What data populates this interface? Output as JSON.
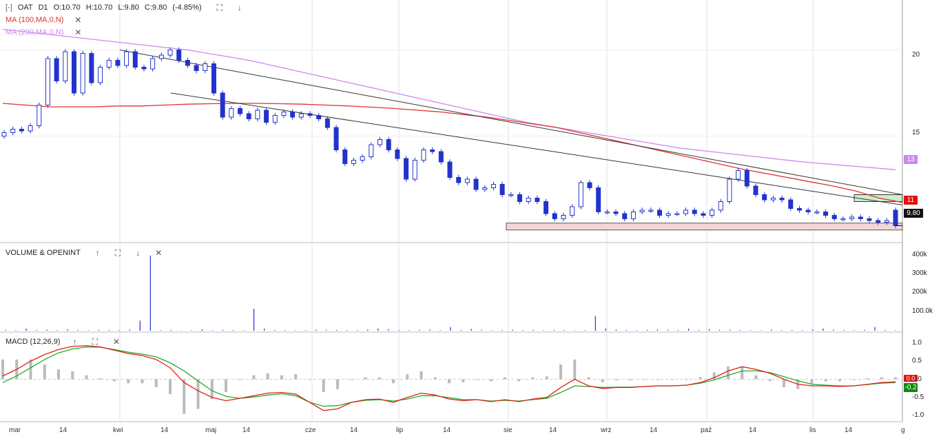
{
  "header": {
    "collapse_icon": "[-]",
    "symbol": "OAT",
    "interval": "D1",
    "open": "O:10.70",
    "high": "H:10.70",
    "low": "L:9.80",
    "close": "C:9.80",
    "change": "(-4.85%)"
  },
  "indicators": {
    "ma100": "MA (100,MA,0,N)",
    "ma200": "MA (200,MA,0,N)",
    "volume": "VOLUME & OPENINT",
    "macd": "MACD (12,26,9)"
  },
  "colors": {
    "candle": "#2233cc",
    "ma100": "#e03030",
    "ma200": "#cc88ee",
    "trendline": "#333333",
    "macd_line": "#e02020",
    "signal_line": "#22aa22",
    "histogram": "#bbbbbb",
    "zone_support": "#f3d6d6",
    "zone_resistance": "#ccefcc"
  },
  "price_axis": {
    "labels": [
      "20",
      "15"
    ],
    "ylim": [
      9.3,
      22.5
    ]
  },
  "volume_axis": {
    "labels": [
      "400k",
      "300k",
      "200k",
      "100.0k"
    ]
  },
  "macd_axis": {
    "labels": [
      "1.0",
      "0.5",
      "0.0",
      "-0.5",
      "-1.0"
    ]
  },
  "badges": {
    "ma200": "13",
    "ma100": "11",
    "last": "9.80",
    "macd": "-0.2",
    "signal": "0.0"
  },
  "x_labels": [
    "mar",
    "14",
    "kwi",
    "14",
    "maj",
    "14",
    "cze",
    "14",
    "lip",
    "14",
    "sie",
    "14",
    "wrz",
    "14",
    "paź",
    "14",
    "lis",
    "14",
    "g"
  ],
  "chart_data": [
    {
      "type": "candlestick",
      "symbol": "OAT",
      "interval": "D1",
      "ylim": [
        9.3,
        22.5
      ],
      "close": [
        15.2,
        15.4,
        15.3,
        15.6,
        16.8,
        19.5,
        18.2,
        19.9,
        17.5,
        19.8,
        18.1,
        19.0,
        19.4,
        19.1,
        19.9,
        19.0,
        18.9,
        19.5,
        19.7,
        20.0,
        19.4,
        19.1,
        18.8,
        19.2,
        17.5,
        16.1,
        16.6,
        16.3,
        16.0,
        16.5,
        15.8,
        16.2,
        16.4,
        16.1,
        16.3,
        16.2,
        16.0,
        15.5,
        14.2,
        13.4,
        13.6,
        13.8,
        14.5,
        14.8,
        14.2,
        13.7,
        12.5,
        13.6,
        14.2,
        14.1,
        13.5,
        12.6,
        12.3,
        12.5,
        11.9,
        12.0,
        12.2,
        11.6,
        11.6,
        11.2,
        11.4,
        11.2,
        10.5,
        10.2,
        10.4,
        10.9,
        12.3,
        12.0,
        10.6,
        10.6,
        10.5,
        10.2,
        10.6,
        10.7,
        10.7,
        10.4,
        10.5,
        10.5,
        10.7,
        10.5,
        10.4,
        10.7,
        11.2,
        12.5,
        13.0,
        12.1,
        11.6,
        11.3,
        11.4,
        11.3,
        10.8,
        10.7,
        10.6,
        10.6,
        10.4,
        10.2,
        10.2,
        10.3,
        10.2,
        10.1,
        10.0,
        10.1,
        9.8
      ],
      "open": [
        15.0,
        15.2,
        15.4,
        15.3,
        15.6,
        16.8,
        19.5,
        18.2,
        19.9,
        17.5,
        19.8,
        18.1,
        19.0,
        19.4,
        19.1,
        19.9,
        19.0,
        18.9,
        19.5,
        19.7,
        20.0,
        19.4,
        19.1,
        18.8,
        19.2,
        17.5,
        16.1,
        16.6,
        16.3,
        16.0,
        16.5,
        15.8,
        16.2,
        16.4,
        16.1,
        16.3,
        16.2,
        16.0,
        15.5,
        14.2,
        13.4,
        13.6,
        13.8,
        14.5,
        14.8,
        14.2,
        13.7,
        12.5,
        13.6,
        14.2,
        14.1,
        13.5,
        12.6,
        12.3,
        12.5,
        11.9,
        12.0,
        12.2,
        11.6,
        11.6,
        11.2,
        11.4,
        11.2,
        10.5,
        10.2,
        10.4,
        10.9,
        12.3,
        12.0,
        10.6,
        10.6,
        10.5,
        10.2,
        10.6,
        10.7,
        10.7,
        10.4,
        10.5,
        10.5,
        10.7,
        10.5,
        10.4,
        10.7,
        11.2,
        12.5,
        13.0,
        12.1,
        11.6,
        11.3,
        11.4,
        11.3,
        10.8,
        10.7,
        10.6,
        10.6,
        10.4,
        10.2,
        10.2,
        10.3,
        10.2,
        10.1,
        10.0,
        10.7
      ],
      "ma100": [
        16.9,
        16.8,
        16.7,
        16.7,
        16.7,
        16.75,
        16.75,
        16.8,
        16.85,
        16.88,
        16.9,
        16.9,
        16.88,
        16.85,
        16.8,
        16.75,
        16.68,
        16.6,
        16.5,
        16.4,
        16.25,
        16.1,
        15.9,
        15.7,
        15.5,
        15.2,
        14.9,
        14.6,
        14.3,
        14.0,
        13.7,
        13.4,
        13.1,
        12.85,
        12.6,
        12.35,
        12.1,
        11.8,
        11.4,
        11.15
      ],
      "ma200": [
        21.2,
        21.0,
        20.8,
        20.6,
        20.4,
        20.2,
        20.0,
        19.7,
        19.4,
        19.0,
        18.6,
        18.2,
        17.8,
        17.4,
        17.0,
        16.6,
        16.2,
        15.8,
        15.5,
        15.2,
        14.9,
        14.6,
        14.3,
        14.1,
        13.9,
        13.7,
        13.5,
        13.35,
        13.2,
        13.05
      ],
      "trendlines": [
        [
          20.0,
          11.6
        ],
        [
          17.5,
          11.0
        ]
      ],
      "support_zone": [
        9.55,
        9.95
      ],
      "resistance_zone": [
        11.2,
        11.6
      ],
      "last": 9.8
    },
    {
      "type": "bar",
      "title": "VOLUME & OPENINT",
      "ylim": [
        0,
        420000
      ],
      "values": [
        5000,
        3000,
        12000,
        4000,
        6000,
        3000,
        8000,
        4000,
        3000,
        5000,
        4000,
        3000,
        6000,
        55000,
        410000,
        3000,
        4000,
        2000,
        3000,
        8000,
        3000,
        5000,
        4000,
        3000,
        120000,
        12000,
        4000,
        3000,
        2000,
        3000,
        6000,
        5000,
        4000,
        3000,
        3000,
        7000,
        12000,
        9000,
        4000,
        3000,
        5000,
        6000,
        3000,
        20000,
        4000,
        10000,
        5000,
        3000,
        4000,
        6000,
        3000,
        5000,
        3000,
        4000,
        4000,
        2000,
        3000,
        80000,
        12000,
        6000,
        4000,
        3000,
        5000,
        7000,
        5000,
        4000,
        12000,
        4000,
        9000,
        5000,
        5000,
        4000,
        3000,
        2000,
        6000,
        3000,
        4000,
        3000,
        8000,
        12000,
        6000,
        4000,
        3000,
        5000,
        20000,
        4000,
        3000
      ]
    },
    {
      "type": "line",
      "title": "MACD (12,26,9)",
      "ylim": [
        -1.1,
        1.2
      ],
      "macd": [
        0.1,
        0.3,
        0.55,
        0.75,
        0.9,
        1.0,
        1.02,
        0.98,
        0.88,
        0.78,
        0.72,
        0.6,
        0.35,
        -0.1,
        -0.35,
        -0.55,
        -0.65,
        -0.58,
        -0.5,
        -0.42,
        -0.4,
        -0.45,
        -0.7,
        -0.95,
        -0.9,
        -0.7,
        -0.62,
        -0.6,
        -0.7,
        -0.55,
        -0.42,
        -0.48,
        -0.6,
        -0.65,
        -0.62,
        -0.68,
        -0.62,
        -0.68,
        -0.6,
        -0.55,
        -0.25,
        0.0,
        -0.2,
        -0.28,
        -0.25,
        -0.25,
        -0.22,
        -0.2,
        -0.2,
        -0.18,
        -0.1,
        0.05,
        0.25,
        0.38,
        0.3,
        0.18,
        0.0,
        -0.15,
        -0.2,
        -0.2,
        -0.22,
        -0.2,
        -0.15,
        -0.1,
        -0.08
      ],
      "signal": [
        -0.1,
        0.1,
        0.35,
        0.6,
        0.8,
        0.92,
        0.98,
        0.97,
        0.9,
        0.82,
        0.76,
        0.68,
        0.5,
        0.25,
        -0.05,
        -0.35,
        -0.52,
        -0.58,
        -0.54,
        -0.48,
        -0.44,
        -0.5,
        -0.7,
        -0.82,
        -0.8,
        -0.7,
        -0.64,
        -0.62,
        -0.66,
        -0.6,
        -0.5,
        -0.5,
        -0.56,
        -0.62,
        -0.62,
        -0.66,
        -0.64,
        -0.66,
        -0.62,
        -0.58,
        -0.4,
        -0.2,
        -0.22,
        -0.25,
        -0.24,
        -0.24,
        -0.22,
        -0.2,
        -0.2,
        -0.18,
        -0.12,
        -0.02,
        0.12,
        0.25,
        0.26,
        0.2,
        0.08,
        -0.05,
        -0.15,
        -0.18,
        -0.2,
        -0.2,
        -0.16,
        -0.12,
        -0.1
      ]
    }
  ]
}
